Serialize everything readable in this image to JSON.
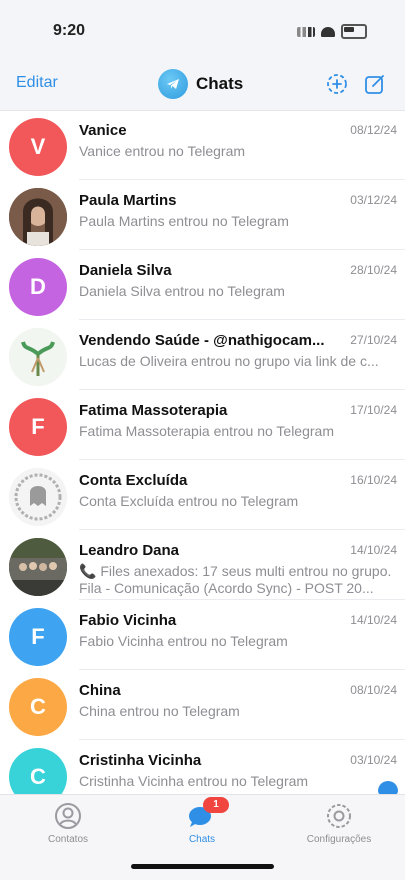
{
  "status_bar": {
    "time": "9:20"
  },
  "navbar": {
    "edit_label": "Editar",
    "title": "Chats"
  },
  "chats": [
    {
      "name": "Vanice",
      "date": "08/12/24",
      "preview": "Vanice entrou no Telegram",
      "initial": "V",
      "avatar_color": "#f2575a",
      "avatar_kind": "initial"
    },
    {
      "name": "Paula Martins",
      "date": "03/12/24",
      "preview": "Paula Martins entrou no Telegram",
      "initial": "",
      "avatar_color": "#6a4a3a",
      "avatar_kind": "photo-person"
    },
    {
      "name": "Daniela Silva",
      "date": "28/10/24",
      "preview": "Daniela Silva entrou no Telegram",
      "initial": "D",
      "avatar_color": "#c464e0",
      "avatar_kind": "initial"
    },
    {
      "name": "Vendendo Saúde - @nathigocam...",
      "date": "27/10/24",
      "preview": "Lucas de Oliveira entrou no grupo via link de c...",
      "initial": "",
      "avatar_color": "#eef4ee",
      "avatar_kind": "photo-plant"
    },
    {
      "name": "Fatima Massoterapia",
      "date": "17/10/24",
      "preview": "Fatima Massoterapia entrou no Telegram",
      "initial": "F",
      "avatar_color": "#f2575a",
      "avatar_kind": "initial"
    },
    {
      "name": "Conta Excluída",
      "date": "16/10/24",
      "preview": "Conta Excluída entrou no Telegram",
      "initial": "",
      "avatar_color": "#f2f2f2",
      "avatar_kind": "ghost"
    },
    {
      "name": "Leandro Dana",
      "date": "14/10/24",
      "preview": "📞 Files anexados: 17 seus multi entrou no grupo. Fila - Comunicação (Acordo Sync) - POST 20...",
      "initial": "",
      "avatar_color": "#5b6a4a",
      "avatar_kind": "photo-group"
    },
    {
      "name": "Fabio Vicinha",
      "date": "14/10/24",
      "preview": "Fabio Vicinha entrou no Telegram",
      "initial": "F",
      "avatar_color": "#3ea3f0",
      "avatar_kind": "initial"
    },
    {
      "name": "China",
      "date": "08/10/24",
      "preview": "China entrou no Telegram",
      "initial": "C",
      "avatar_color": "#fba845",
      "avatar_kind": "initial"
    },
    {
      "name": "Cristinha Vicinha",
      "date": "03/10/24",
      "preview": "Cristinha Vicinha entrou no Telegram",
      "initial": "C",
      "avatar_color": "#37d3d8",
      "avatar_kind": "initial"
    }
  ],
  "tabs": [
    {
      "label": "Contatos",
      "icon": "person-icon",
      "active": false
    },
    {
      "label": "Chats",
      "icon": "chat-bubbles-icon",
      "active": true,
      "badge": "1"
    },
    {
      "label": "Configurações",
      "icon": "gear-icon",
      "active": false
    }
  ],
  "colors": {
    "accent": "#2f8fe6",
    "badge": "#f0463f"
  }
}
